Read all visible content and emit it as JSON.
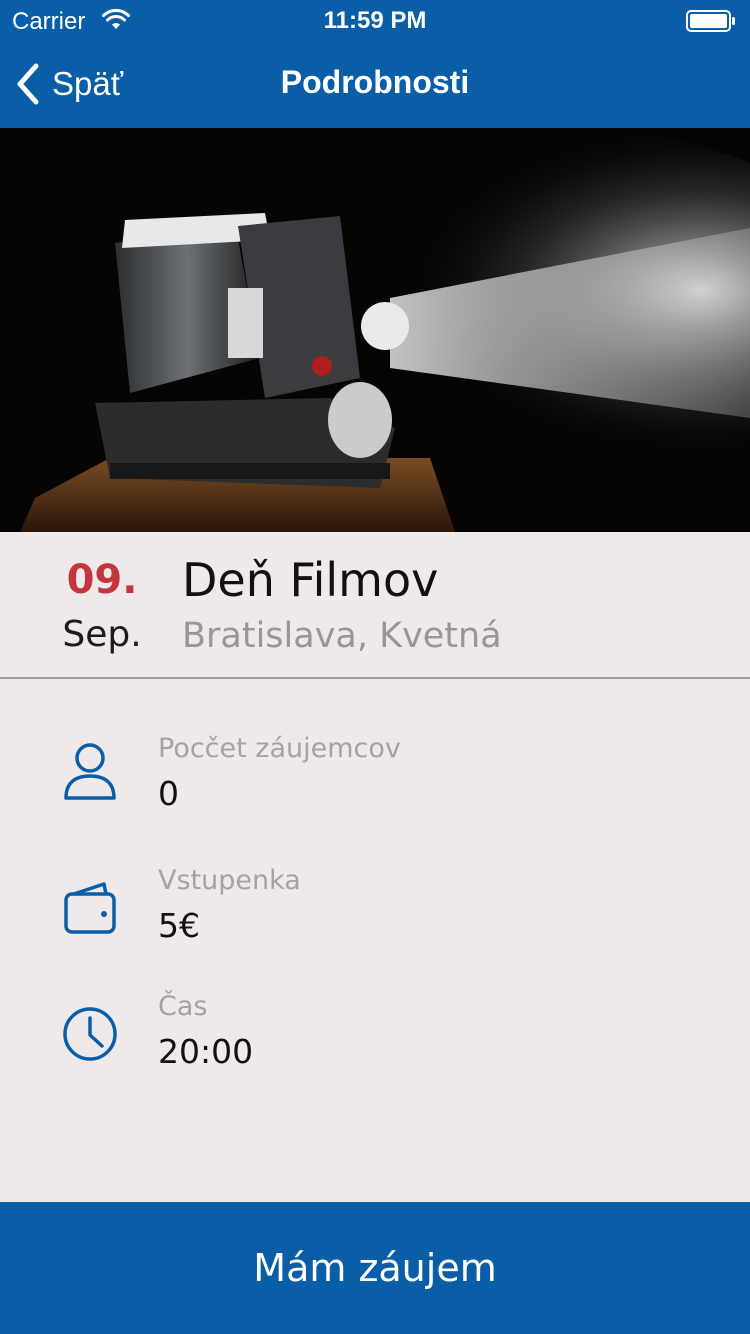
{
  "statusbar": {
    "carrier": "Carrier",
    "time": "11:59 PM"
  },
  "navbar": {
    "back_label": "Späť",
    "title": "Podrobnosti"
  },
  "event": {
    "day": "09.",
    "month": "Sep.",
    "title": "Deň Filmov",
    "place": "Bratislava, Kvetná"
  },
  "details": [
    {
      "icon": "person-icon",
      "label": "Pocčet záujemcov",
      "value": "0"
    },
    {
      "icon": "wallet-icon",
      "label": "Vstupenka",
      "value": "5€"
    },
    {
      "icon": "clock-icon",
      "label": "Čas",
      "value": "20:00"
    }
  ],
  "cta": {
    "label": "Mám záujem"
  },
  "colors": {
    "brand": "#0a5ea8",
    "date_accent": "#c4353d",
    "background": "#efe9ea"
  }
}
